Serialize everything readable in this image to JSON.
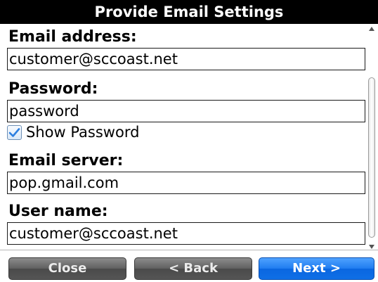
{
  "title": "Provide Email Settings",
  "form": {
    "email_label": "Email address:",
    "email_value": "customer@sccoast.net",
    "password_label": "Password:",
    "password_value": "password",
    "show_password_label": "Show Password",
    "show_password_checked": true,
    "server_label": "Email server:",
    "server_value": "pop.gmail.com",
    "username_label": "User name:",
    "username_value": "customer@sccoast.net"
  },
  "buttons": {
    "close": "Close",
    "back": "< Back",
    "next": "Next >"
  },
  "colors": {
    "title_bg": "#000000",
    "next_button": "#1f7cf0",
    "secondary_button": "#5f5f5f",
    "checkmark": "#2d7fe0"
  },
  "icons": {
    "checkbox": "checkmark-icon",
    "scroll_up": "scroll-up-arrow-icon",
    "scroll_down": "scroll-down-arrow-icon"
  }
}
